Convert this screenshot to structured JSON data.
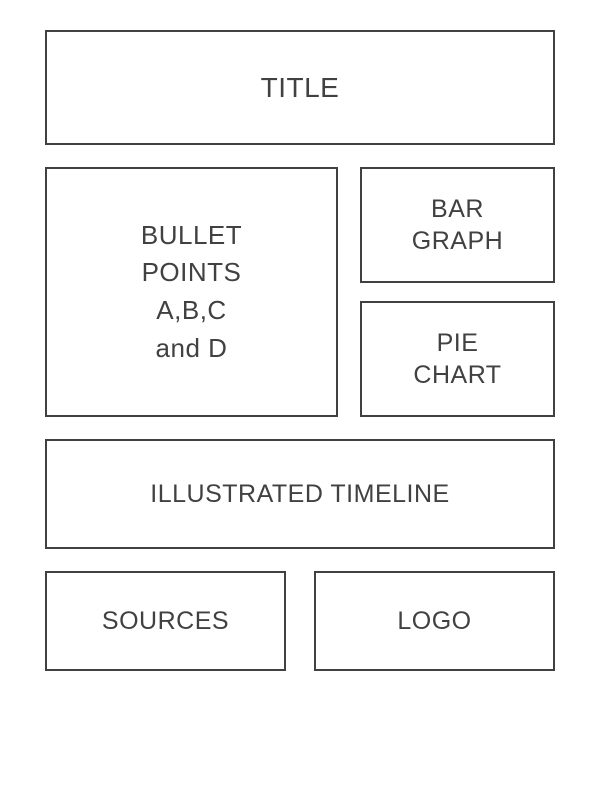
{
  "title": "TITLE",
  "bullet": {
    "line1": "BULLET",
    "line2": "POINTS",
    "line3": "A,B,C",
    "line4": "and D"
  },
  "bar": {
    "line1": "BAR",
    "line2": "GRAPH"
  },
  "pie": {
    "line1": "PIE",
    "line2": "CHART"
  },
  "timeline": "ILLUSTRATED TIMELINE",
  "sources": "SOURCES",
  "logo": "LOGO"
}
